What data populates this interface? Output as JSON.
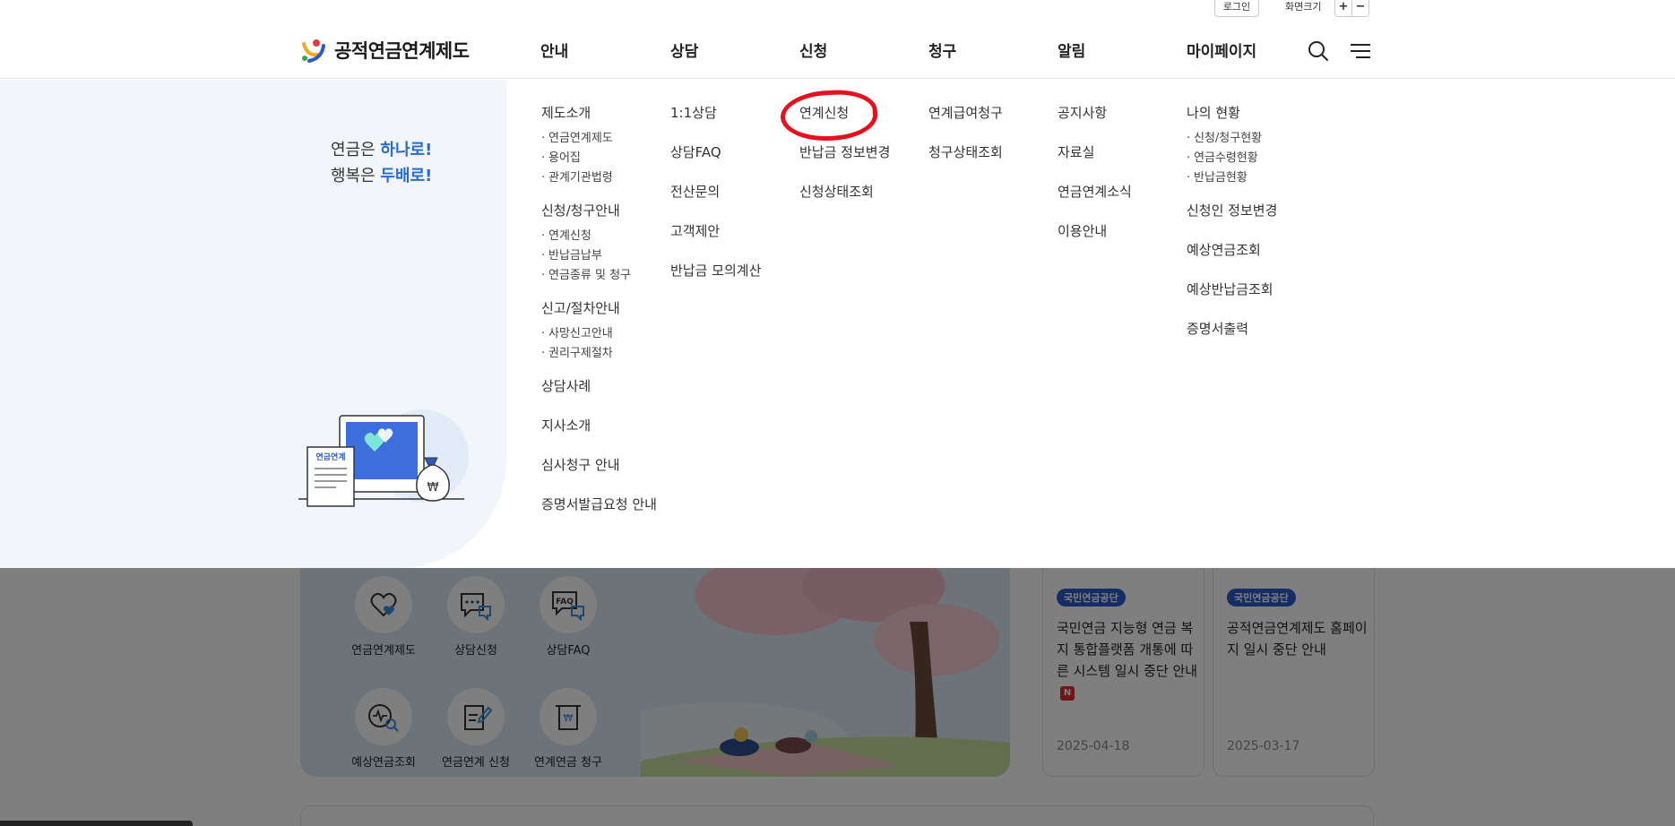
{
  "util": {
    "login": "로그인",
    "zoom_label": "화면크기",
    "zoom_plus": "+",
    "zoom_minus": "−"
  },
  "header": {
    "logo_text": "공적연금연계제도",
    "nav": [
      "안내",
      "상담",
      "신청",
      "청구",
      "알림",
      "마이페이지"
    ],
    "icons": [
      "search-icon",
      "menu-icon"
    ]
  },
  "mega_menu": {
    "slogan": {
      "line1_prefix": "연금은 ",
      "line1_highlight": "하나로!",
      "line2_prefix": "행복은 ",
      "line2_highlight": "두배로!"
    },
    "illustration": {
      "doc_label": "연금연계",
      "bag_symbol": "₩"
    },
    "columns": {
      "guide": [
        {
          "label": "제도소개",
          "subs": [
            "연금연계제도",
            "용어집",
            "관계기관법령"
          ]
        },
        {
          "label": "신청/청구안내",
          "subs": [
            "연계신청",
            "반납금납부",
            "연금종류 및 청구"
          ]
        },
        {
          "label": "신고/절차안내",
          "subs": [
            "사망신고안내",
            "권리구제절차"
          ]
        },
        {
          "label": "상담사례",
          "subs": []
        },
        {
          "label": "지사소개",
          "subs": []
        },
        {
          "label": "심사청구 안내",
          "subs": []
        },
        {
          "label": "증명서발급요청 안내",
          "subs": []
        }
      ],
      "consult": [
        "1:1상담",
        "상담FAQ",
        "전산문의",
        "고객제안",
        "반납금 모의계산"
      ],
      "apply": [
        "연계신청",
        "반납금 정보변경",
        "신청상태조회"
      ],
      "claim": [
        "연계급여청구",
        "청구상태조회"
      ],
      "notice": [
        "공지사항",
        "자료실",
        "연금연계소식",
        "이용안내"
      ],
      "mypage": [
        {
          "label": "나의 현황",
          "subs": [
            "신청/청구현황",
            "연금수령현황",
            "반납금현황"
          ]
        },
        {
          "label": "신청인 정보변경",
          "subs": []
        },
        {
          "label": "예상연금조회",
          "subs": []
        },
        {
          "label": "예상반납금조회",
          "subs": []
        },
        {
          "label": "증명서출력",
          "subs": []
        }
      ]
    }
  },
  "quick_menu": [
    {
      "label": "연금연계제도",
      "icon": "heart-chat-icon"
    },
    {
      "label": "상담신청",
      "icon": "chat-bubble-icon"
    },
    {
      "label": "상담FAQ",
      "icon": "faq-icon"
    },
    {
      "label": "예상연금조회",
      "icon": "wave-search-icon"
    },
    {
      "label": "연금연계 신청",
      "icon": "document-pen-icon"
    },
    {
      "label": "연계연금 청구",
      "icon": "money-receipt-icon"
    }
  ],
  "news": [
    {
      "badge": "국민연금공단",
      "title": "국민연금 지능형 연금 복지 통합플랫폼 개통에 따른 시스템 일시 중단 안내",
      "new_badge": "N",
      "date": "2025-04-18"
    },
    {
      "badge": "국민연금공단",
      "title": "공적연금연계제도 홈페이지 일시 중단 안내",
      "date": "2025-03-17"
    }
  ],
  "colors": {
    "accent_blue": "#2a6ad6",
    "highlight_circle": "#e8101d",
    "mega_left_bg": "#f2f5fa"
  }
}
